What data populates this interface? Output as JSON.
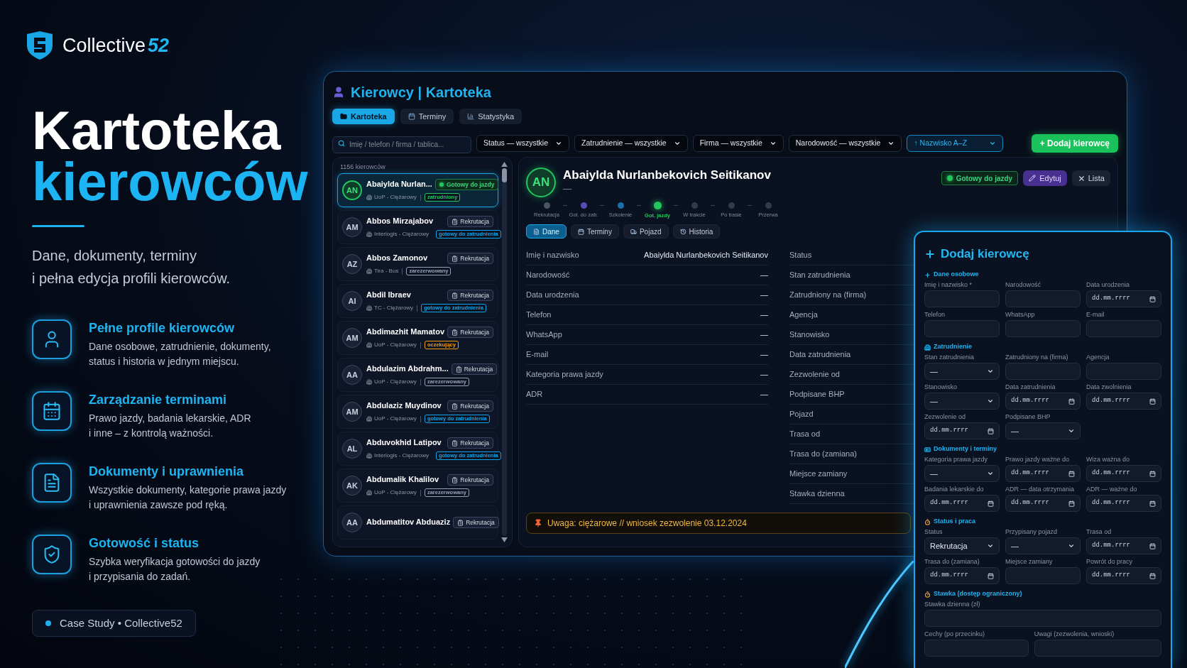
{
  "brand": {
    "name": "Collective",
    "suffix": "52"
  },
  "hero": {
    "title": "Kartoteka",
    "accent": "kierowców",
    "subtitle": "Dane, dokumenty, terminy\ni pełna edycja profili kierowców."
  },
  "features": [
    {
      "kind": "person",
      "title": "Pełne profile kierowców",
      "text": "Dane osobowe, zatrudnienie, dokumenty,\nstatus i historia w jednym miejscu."
    },
    {
      "kind": "calendar",
      "title": "Zarządzanie terminami",
      "text": "Prawo jazdy, badania lekarskie, ADR\ni inne – z kontrolą ważności."
    },
    {
      "kind": "document",
      "title": "Dokumenty i uprawnienia",
      "text": "Wszystkie dokumenty, kategorie prawa jazdy\ni uprawnienia zawsze pod ręką."
    },
    {
      "kind": "shield",
      "title": "Gotowość i status",
      "text": "Szybka weryfikacja gotowości do jazdy\ni przypisania do zadań."
    }
  ],
  "case_study": {
    "text": "Case Study • Collective52"
  },
  "app": {
    "title": "Kierowcy | Kartoteka",
    "tabs": [
      {
        "kind": "folder",
        "label": "Kartoteka",
        "selected": true
      },
      {
        "kind": "calendar",
        "label": "Terminy",
        "selected": false
      },
      {
        "kind": "chart",
        "label": "Statystyka",
        "selected": false
      }
    ],
    "search": {
      "placeholder": "Imię / telefon / firma / tablica..."
    },
    "filters": [
      {
        "kind": "filter",
        "value": "Status — wszystkie"
      },
      {
        "kind": "filter",
        "value": "Zatrudnienie — wszystkie"
      },
      {
        "kind": "filter",
        "value": "Firma — wszystkie"
      },
      {
        "kind": "filter",
        "value": "Narodowość — wszystkie"
      },
      {
        "kind": "sort",
        "value": "↑ Nazwisko A–Z"
      }
    ],
    "add_button": "+ Dodaj kierowcę"
  },
  "list": {
    "count": "1156 kierowców",
    "items": [
      {
        "initials": "AN",
        "name": "Abaiylda Nurlan...",
        "company": "UoP - Ciężarowy",
        "tag": {
          "text": "zatrudniony",
          "color": "#22c55e"
        },
        "status": {
          "kind": "ready",
          "label": "Gotowy do jazdy"
        },
        "selected": true
      },
      {
        "initials": "AM",
        "name": "Abbos Mirzajabov",
        "company": "Interlogis - Ciężarowy",
        "tag": {
          "text": "gotowy do zatrudnienia",
          "color": "#0ea5e9"
        },
        "status": {
          "kind": "recruitment",
          "label": "Rekrutacja"
        },
        "selected": false
      },
      {
        "initials": "AZ",
        "name": "Abbos Zamonov",
        "company": "Tira - Bus",
        "tag": {
          "text": "zarezerwowany",
          "color": "#94a3b8"
        },
        "status": {
          "kind": "recruitment",
          "label": "Rekrutacja"
        },
        "selected": false
      },
      {
        "initials": "AI",
        "name": "Abdil Ibraev",
        "company": "TC - Ciężarowy",
        "tag": {
          "text": "gotowy do zatrudnienia",
          "color": "#0ea5e9"
        },
        "status": {
          "kind": "recruitment",
          "label": "Rekrutacja"
        },
        "selected": false
      },
      {
        "initials": "AM",
        "name": "Abdimazhit Mamatov",
        "company": "UoP - Ciężarowy",
        "tag": {
          "text": "oczekujący",
          "color": "#f59e0b"
        },
        "status": {
          "kind": "recruitment",
          "label": "Rekrutacja"
        },
        "selected": false
      },
      {
        "initials": "AA",
        "name": "Abdulazim Abdrahm...",
        "company": "UoP - Ciężarowy",
        "tag": {
          "text": "zarezerwowany",
          "color": "#94a3b8"
        },
        "status": {
          "kind": "recruitment",
          "label": "Rekrutacja"
        },
        "selected": false
      },
      {
        "initials": "AM",
        "name": "Abdulaziz Muydinov",
        "company": "UoP - Ciężarowy",
        "tag": {
          "text": "gotowy do zatrudnienia",
          "color": "#0ea5e9"
        },
        "status": {
          "kind": "recruitment",
          "label": "Rekrutacja"
        },
        "selected": false
      },
      {
        "initials": "AL",
        "name": "Abduvokhid Latipov",
        "company": "Interlogis - Ciężarowy",
        "tag": {
          "text": "gotowy do zatrudnienia",
          "color": "#0ea5e9"
        },
        "status": {
          "kind": "recruitment",
          "label": "Rekrutacja"
        },
        "selected": false
      },
      {
        "initials": "AK",
        "name": "Abdumalik Khalilov",
        "company": "UoP - Ciężarowy",
        "tag": {
          "text": "zarezerwowany",
          "color": "#94a3b8"
        },
        "status": {
          "kind": "recruitment",
          "label": "Rekrutacja"
        },
        "selected": false
      },
      {
        "initials": "AA",
        "name": "Abdumatitov Abduaziz",
        "status": {
          "kind": "recruitment",
          "label": "Rekrutacja"
        },
        "selected": false
      }
    ]
  },
  "detail": {
    "initials": "AN",
    "name": "Abaiylda Nurlanbekovich Seitikanov",
    "subtitle": "—",
    "status": {
      "kind": "ready",
      "label": "Gotowy do jazdy"
    },
    "edit_button": "Edytuj",
    "close_button": "Lista",
    "steps": [
      {
        "label": "Rekrutacja",
        "color": "#4b5563",
        "selected": false
      },
      {
        "label": "Got. do zatr.",
        "color": "#5b4bb5",
        "selected": false
      },
      {
        "label": "Szkolenie",
        "color": "#1e6fa8",
        "selected": false
      },
      {
        "label": "Got. jazdy",
        "color": "#22c55e",
        "selected": true
      },
      {
        "label": "W trakcie",
        "color": "#323b4c",
        "selected": false
      },
      {
        "label": "Po trasie",
        "color": "#323b4c",
        "selected": false
      },
      {
        "label": "Przerwa",
        "color": "#323b4c",
        "selected": false
      }
    ],
    "tabs": [
      {
        "kind": "document",
        "label": "Dane",
        "selected": true
      },
      {
        "kind": "calendar",
        "label": "Terminy",
        "selected": false
      },
      {
        "kind": "truck",
        "label": "Pojazd",
        "selected": false
      },
      {
        "kind": "history",
        "label": "Historia",
        "selected": false
      }
    ],
    "fields": [
      {
        "label": "Imię i nazwisko",
        "value": "Abaiylda Nurlanbekovich Seitikanov"
      },
      {
        "label": "Narodowość",
        "value": "—"
      },
      {
        "label": "Data urodzenia",
        "value": "—"
      },
      {
        "label": "Telefon",
        "value": "—"
      },
      {
        "label": "WhatsApp",
        "value": "—"
      },
      {
        "label": "E-mail",
        "value": "—"
      },
      {
        "label": "Kategoria prawa jazdy",
        "value": "—"
      },
      {
        "label": "ADR",
        "value": "—"
      }
    ],
    "side_fields": [
      {
        "label": "Status"
      },
      {
        "label": "Stan zatrudnienia"
      },
      {
        "label": "Zatrudniony na (firma)"
      },
      {
        "label": "Agencja"
      },
      {
        "label": "Stanowisko"
      },
      {
        "label": "Data zatrudnienia"
      },
      {
        "label": "Zezwolenie od"
      },
      {
        "label": "Podpisane BHP"
      },
      {
        "label": "Pojazd"
      },
      {
        "label": "Trasa od"
      },
      {
        "label": "Trasa do (zamiana)"
      },
      {
        "label": "Miejsce zamiany"
      },
      {
        "label": "Stawka dzienna"
      }
    ],
    "notice": "Uwaga: ciężarowe // wniosek zezwolenie 03.12.2024"
  },
  "form": {
    "title": "Dodaj kierowcę",
    "sections": [
      {
        "kind": "personal",
        "title": "Dane osobowe",
        "rows": [
          [
            {
              "kind": "text",
              "label": "Imię i nazwisko *"
            },
            {
              "kind": "text",
              "label": "Narodowość"
            },
            {
              "kind": "date",
              "label": "Data urodzenia",
              "placeholder": "dd.mm.rrrr"
            }
          ],
          [
            {
              "kind": "text",
              "label": "Telefon"
            },
            {
              "kind": "text",
              "label": "WhatsApp"
            },
            {
              "kind": "text",
              "label": "E-mail"
            }
          ]
        ]
      },
      {
        "kind": "employment",
        "title": "Zatrudnienie",
        "rows": [
          [
            {
              "kind": "select",
              "label": "Stan zatrudnienia",
              "value": "—"
            },
            {
              "kind": "text",
              "label": "Zatrudniony na (firma)"
            },
            {
              "kind": "text",
              "label": "Agencja"
            }
          ],
          [
            {
              "kind": "select",
              "label": "Stanowisko",
              "value": "—"
            },
            {
              "kind": "date",
              "label": "Data zatrudnienia",
              "placeholder": "dd.mm.rrrr"
            },
            {
              "kind": "date",
              "label": "Data zwolnienia",
              "placeholder": "dd.mm.rrrr"
            }
          ],
          [
            {
              "kind": "date",
              "label": "Zezwolenie od",
              "placeholder": "dd.mm.rrrr"
            },
            {
              "kind": "select",
              "label": "Podpisane BHP",
              "value": "—"
            }
          ]
        ]
      },
      {
        "kind": "documents",
        "title": "Dokumenty i terminy",
        "rows": [
          [
            {
              "kind": "select",
              "label": "Kategoria prawa jazdy",
              "value": "—"
            },
            {
              "kind": "date",
              "label": "Prawo jazdy ważne do",
              "placeholder": "dd.mm.rrrr"
            },
            {
              "kind": "date",
              "label": "Wiza ważna do",
              "placeholder": "dd.mm.rrrr"
            }
          ],
          [
            {
              "kind": "date",
              "label": "Badania lekarskie do",
              "placeholder": "dd.mm.rrrr"
            },
            {
              "kind": "date",
              "label": "ADR — data otrzymania",
              "placeholder": "dd.mm.rrrr"
            },
            {
              "kind": "date",
              "label": "ADR — ważne do",
              "placeholder": "dd.mm.rrrr"
            }
          ]
        ]
      },
      {
        "kind": "status",
        "title": "Status i praca",
        "rows": [
          [
            {
              "kind": "select",
              "label": "Status",
              "value": "Rekrutacja"
            },
            {
              "kind": "select",
              "label": "Przypisany pojazd",
              "value": "—"
            },
            {
              "kind": "date",
              "label": "Trasa od",
              "placeholder": "dd.mm.rrrr"
            }
          ],
          [
            {
              "kind": "date",
              "label": "Trasa do (zamiana)",
              "placeholder": "dd.mm.rrrr"
            },
            {
              "kind": "text",
              "label": "Miejsce zamiany"
            },
            {
              "kind": "date",
              "label": "Powrót do pracy",
              "placeholder": "dd.mm.rrrr"
            }
          ]
        ]
      },
      {
        "kind": "rate",
        "title": "Stawka (dostęp ograniczony)",
        "rows": [
          [
            {
              "kind": "text",
              "label": "Stawka dzienna (zł)"
            }
          ],
          [
            {
              "kind": "text",
              "label": "Cechy (po przecinku)"
            },
            {
              "kind": "text",
              "label": "Uwagi (zezwolenia, wnioski)"
            }
          ]
        ]
      }
    ]
  }
}
